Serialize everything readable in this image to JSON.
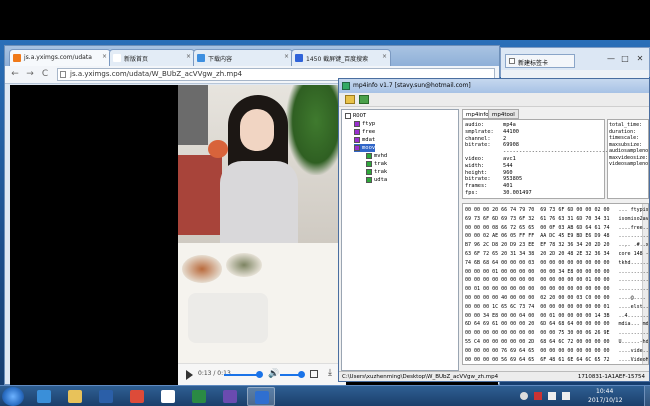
{
  "chrome": {
    "tabs": [
      {
        "label": "js.a.yximgs.com/udata",
        "close": "×",
        "favicon_color": "#f07a1a"
      },
      {
        "label": "新版首页",
        "close": "×",
        "favicon_color": "#ffffff"
      },
      {
        "label": "下载内容",
        "close": "×",
        "favicon_color": "#3d8fe0"
      },
      {
        "label": "1450 截屏键_百度搜索",
        "close": "×",
        "favicon_color": "#2f63d9"
      }
    ],
    "back": "←",
    "forward": "→",
    "reload": "C",
    "url": "js.a.yximgs.com/udata/W_BUbZ_acVVgw_zh.mp4"
  },
  "video": {
    "time": "0:13 / 0:13",
    "volume_glyph": "🔊",
    "download_glyph": "⤓",
    "progress": 1.0,
    "volume": 0.8
  },
  "mp4info": {
    "title": "mp4info v1.7 [stavy.sun@hotmail.com]",
    "tree": [
      {
        "label": "ROOT",
        "color": "#ffffff"
      },
      {
        "label": "ftyp",
        "color": "#9a2fd0"
      },
      {
        "label": "free",
        "color": "#9a2fd0"
      },
      {
        "label": "mdat",
        "color": "#9a2fd0"
      },
      {
        "label": "moov",
        "color": "#9a2fd0"
      },
      {
        "label": "mvhd",
        "color": "#2ea83a"
      },
      {
        "label": "trak",
        "color": "#2ea83a"
      },
      {
        "label": "trak",
        "color": "#2ea83a"
      },
      {
        "label": "udta",
        "color": "#2ea83a"
      }
    ],
    "subtabs": [
      "mp4info",
      "mp4tool"
    ],
    "info": [
      {
        "k": "audio:",
        "v": "mp4a"
      },
      {
        "k": "smplrate:",
        "v": "44100"
      },
      {
        "k": "channel:",
        "v": "2"
      },
      {
        "k": "bitrate:",
        "v": "69908"
      },
      {
        "k": "",
        "v": "------------------------------------"
      },
      {
        "k": "video:",
        "v": "avc1"
      },
      {
        "k": "width:",
        "v": "544"
      },
      {
        "k": "height:",
        "v": "960"
      },
      {
        "k": "bitrate:",
        "v": "953805"
      },
      {
        "k": "frames:",
        "v": "401"
      },
      {
        "k": "fps:",
        "v": "30.001497"
      }
    ],
    "side": [
      "total_time:",
      "duration:",
      "timescale:",
      "maxsubsize:",
      "audiosampleno",
      "maxvideosize:",
      "videosampleno"
    ],
    "hex": [
      "00 00 00 20 66 74 79 70  69 73 6F 6D 00 00 02 00   ... ftypisom....",
      "69 73 6F 6D 69 73 6F 32  61 76 63 31 6D 70 34 31   isomiso2avc1mp41",
      "00 00 00 08 66 72 65 65  00 0F 03 AB 6D 64 61 74   ....free....mdat",
      "00 00 02 AE 06 05 FF FF  AA DC 45 E9 BD E6 D9 48   ..........E....H",
      "B7 96 2C D8 20 D9 23 EE  EF 78 32 36 34 20 2D 20   ..,. .#..x264 - ",
      "63 6F 72 65 20 31 34 38  20 2D 20 48 2E 32 36 34   core 148 - H.264",
      "74 6B 68 64 00 00 00 03  00 00 00 00 00 00 00 00   tkhd............",
      "00 00 00 01 00 00 00 00  00 00 34 E8 00 00 00 00   ..........4.....",
      "00 00 00 00 00 00 00 00  00 00 00 00 00 01 00 00   ................",
      "00 01 00 00 00 00 00 00  00 00 00 00 00 00 00 00   ................",
      "00 00 00 00 40 00 00 00  02 20 00 00 03 C0 00 00   ....@.... ......",
      "00 00 00 1C 65 6C 73 74  00 00 00 00 00 00 00 01   ....elst........",
      "00 00 34 E8 00 00 04 00  00 01 00 00 00 00 14 3B   ..4............;",
      "6D 64 69 61 00 00 00 20  6D 64 68 64 00 00 00 00   mdia... mdhd....",
      "00 00 00 00 00 00 00 00  00 00 75 30 00 06 26 9E   ..........u0..&.",
      "55 C4 00 00 00 00 00 2D  68 64 6C 72 00 00 00 00   U......-hdlr....",
      "00 00 00 00 76 69 64 65  00 00 00 00 00 00 00 00   ....vide........",
      "00 00 00 00 56 69 64 65  6F 48 61 6E 64 6C 65 72   ....VideoHandler"
    ],
    "status_left": "C:\\Users\\xuzhenming\\Desktop\\W_BUbZ_acVVgw_zh.mp4",
    "status_right": "1710831-1A1AEF-15754"
  },
  "bgwin": {
    "tab": "新建标签卡",
    "minimize": "—",
    "maximize": "□",
    "close": "✕"
  },
  "taskbar": {
    "time": "10:44",
    "date": "2017/10/12",
    "tasks": [
      {
        "name": "ie",
        "color": "#3a8fd9"
      },
      {
        "name": "explorer",
        "color": "#e8c25a"
      },
      {
        "name": "media",
        "color": "#2b5fa8"
      },
      {
        "name": "chrome",
        "color": "#dd4b39"
      },
      {
        "name": "document",
        "color": "#ffffff"
      },
      {
        "name": "excel",
        "color": "#2a8a44"
      },
      {
        "name": "app",
        "color": "#6a4bb0"
      },
      {
        "name": "mp4info",
        "color": "#2f6fd0"
      }
    ]
  }
}
